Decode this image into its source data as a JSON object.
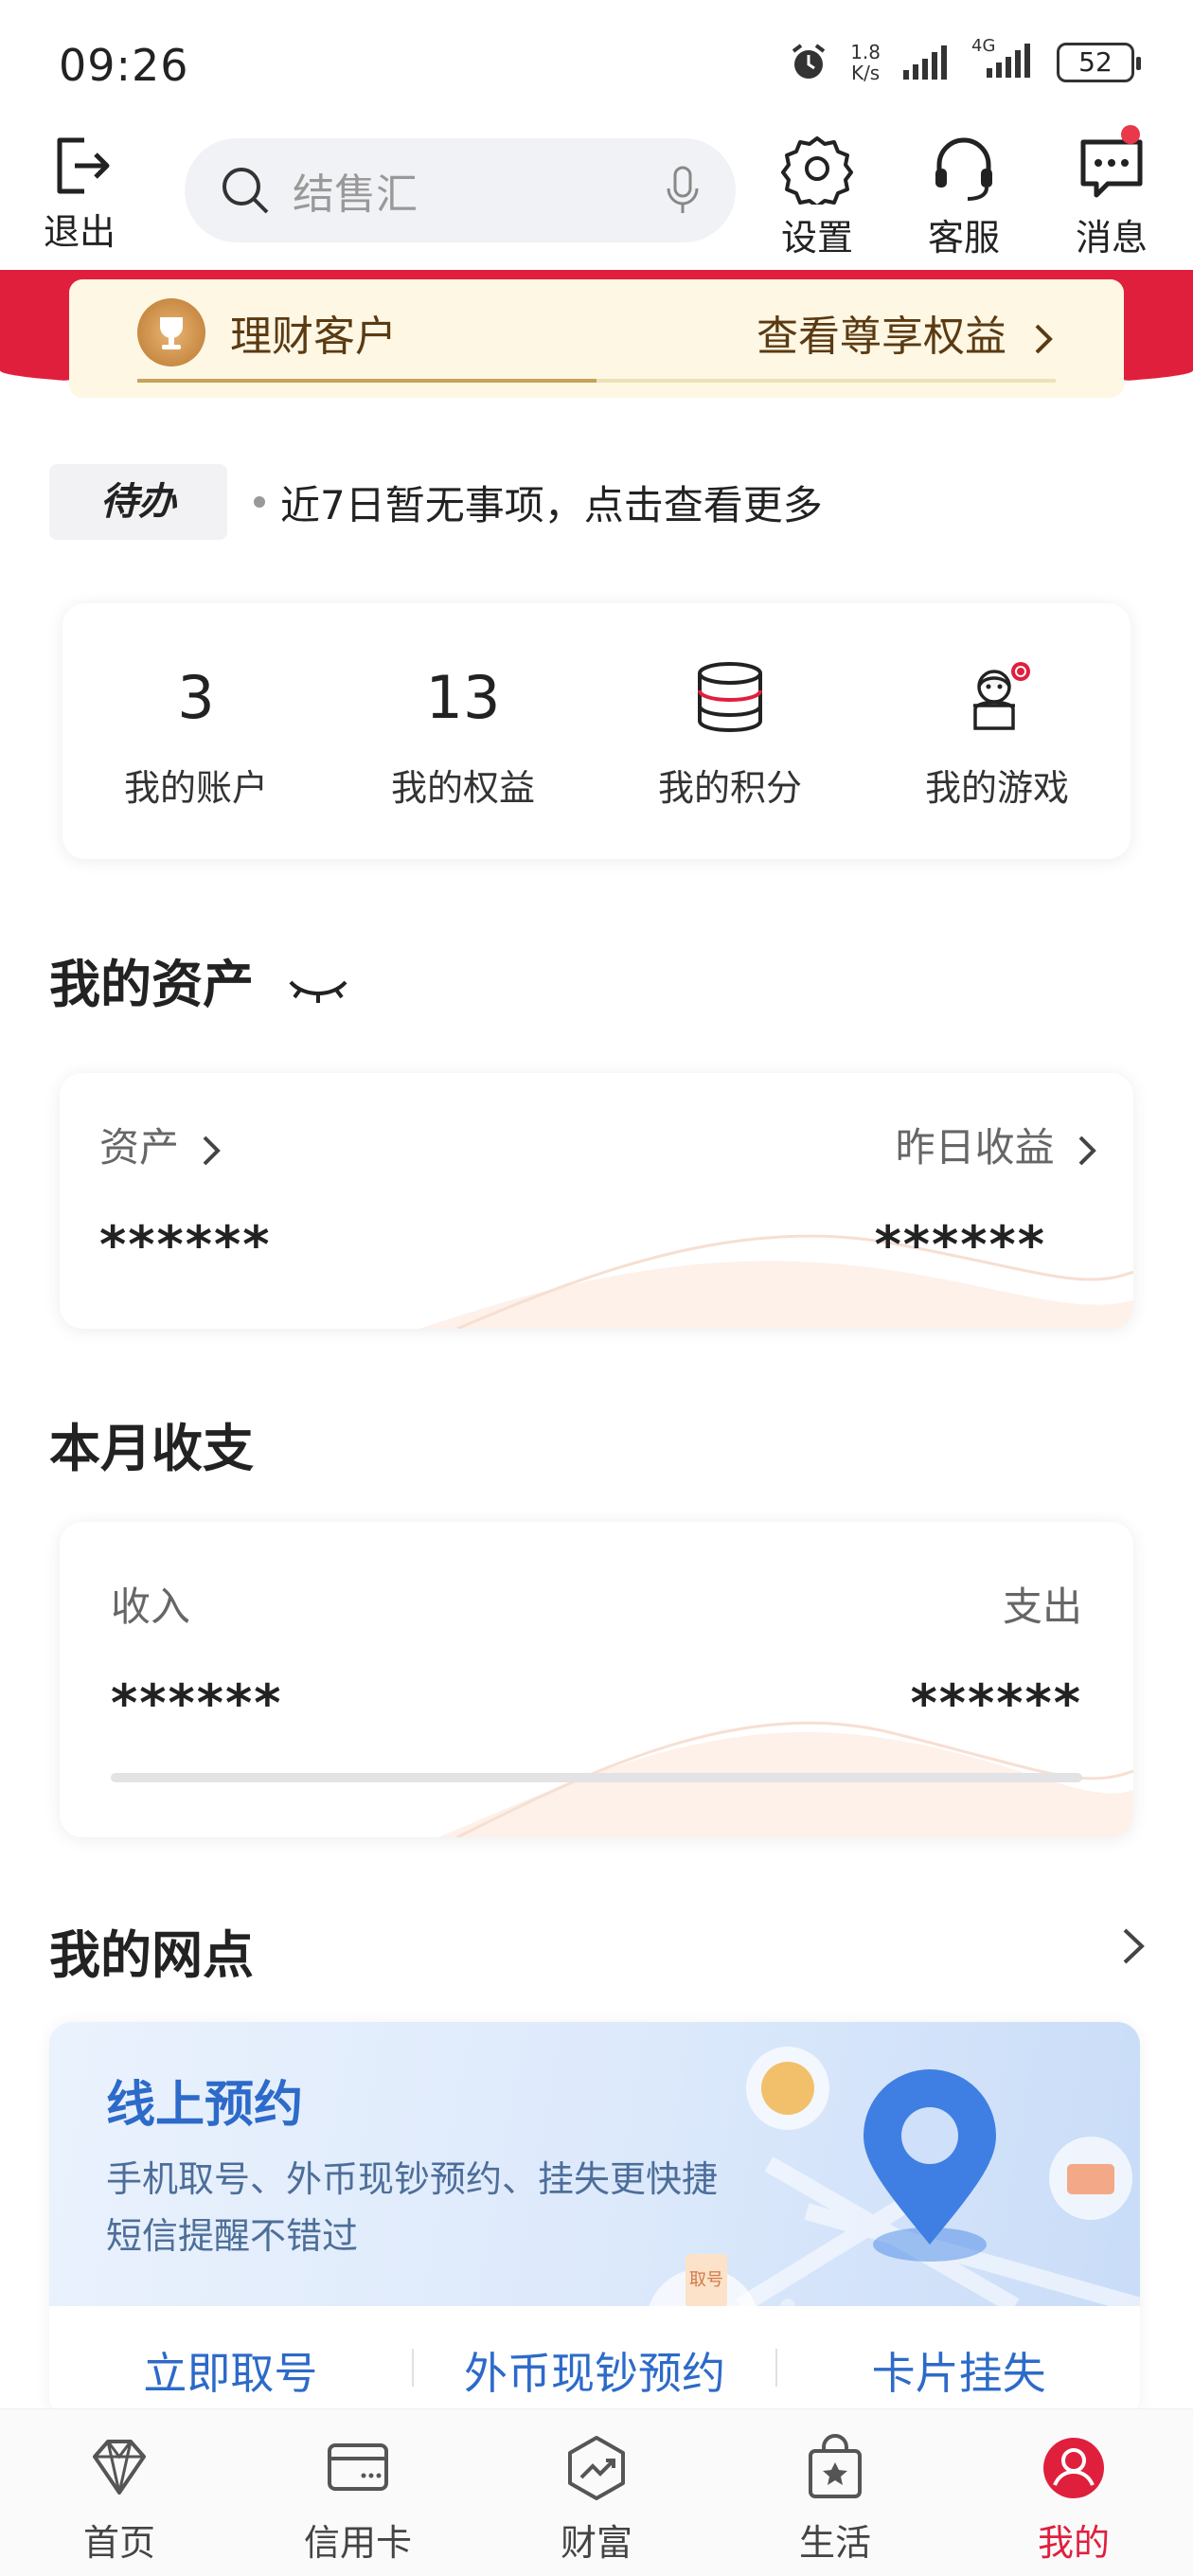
{
  "status_bar": {
    "time": "09:26",
    "net_speed_value": "1.8",
    "net_speed_unit": "K/s",
    "network": "4G",
    "battery": "52"
  },
  "header": {
    "logout_label": "退出",
    "search_placeholder": "结售汇",
    "settings_label": "设置",
    "service_label": "客服",
    "messages_label": "消息"
  },
  "vip": {
    "title": "理财客户",
    "link": "查看尊享权益",
    "progress": 0.5
  },
  "todo": {
    "tag": "待办",
    "text": "近7日暂无事项，点击查看更多"
  },
  "quick_stats": [
    {
      "value": "3",
      "label": "我的账户",
      "icon": ""
    },
    {
      "value": "13",
      "label": "我的权益",
      "icon": ""
    },
    {
      "value": "",
      "label": "我的积分",
      "icon": "database-icon"
    },
    {
      "value": "",
      "label": "我的游戏",
      "icon": "snowman-icon"
    }
  ],
  "assets": {
    "section_title": "我的资产",
    "assets_label": "资产",
    "assets_value": "******",
    "yesterday_label": "昨日收益",
    "yesterday_value": "******"
  },
  "monthly": {
    "section_title": "本月收支",
    "income_label": "收入",
    "income_value": "******",
    "expense_label": "支出",
    "expense_value": "******"
  },
  "outlets": {
    "section_title": "我的网点",
    "hero_title": "线上预约",
    "hero_desc_1": "手机取号、外币现钞预约、挂失更快捷",
    "hero_desc_2": "短信提醒不错过",
    "ticket_text": "取号",
    "actions": [
      "立即取号",
      "外币现钞预约",
      "卡片挂失"
    ]
  },
  "bottom_nav": [
    {
      "label": "首页",
      "icon": "diamond-icon"
    },
    {
      "label": "信用卡",
      "icon": "credit-card-icon"
    },
    {
      "label": "财富",
      "icon": "wealth-chart-icon"
    },
    {
      "label": "生活",
      "icon": "shopping-bag-icon"
    },
    {
      "label": "我的",
      "icon": "user-icon",
      "active": true
    }
  ],
  "colors": {
    "brand_red": "#e01f3d",
    "link_blue": "#2d6ac9",
    "vip_gold": "#5b3a12"
  }
}
